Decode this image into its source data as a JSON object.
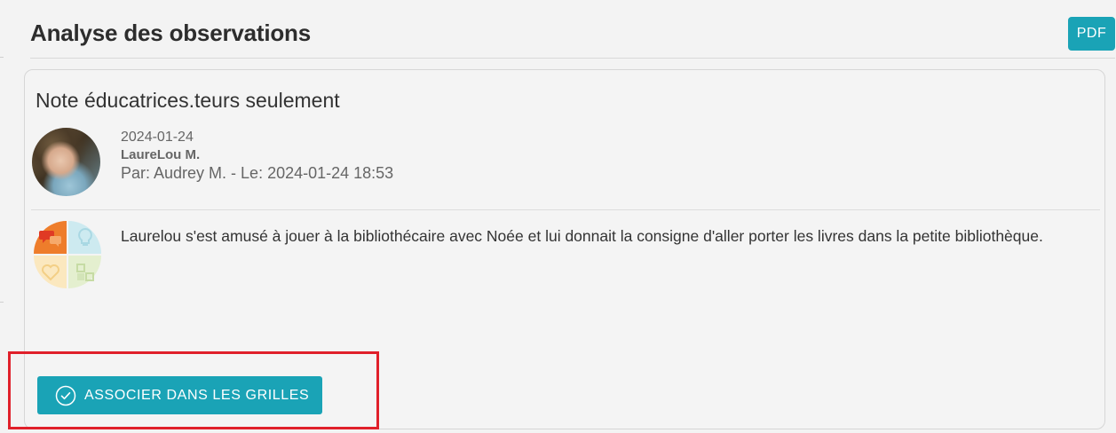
{
  "header": {
    "title": "Analyse des observations",
    "pdf_label": "PDF"
  },
  "note": {
    "title": "Note éducatrices.teurs seulement",
    "date": "2024-01-24",
    "child_name": "LaureLou M.",
    "author_line": "Par: Audrey M. - Le: 2024-01-24 18:53",
    "text": "Laurelou s'est amusé à jouer à la bibliothécaire avec Noée et lui donnait la consigne d'aller porter les livres dans la petite bibliothèque.",
    "development_domains_icon": "development-domains-icon"
  },
  "actions": {
    "associate_label": "ASSOCIER DANS LES GRILLES",
    "associate_icon": "check-circle-icon"
  },
  "colors": {
    "accent": "#1aa3b6",
    "highlight": "#e0202a",
    "domain_social": "#ee7d2b",
    "domain_cognitive": "#cdeaf0",
    "domain_affective": "#fbe8bf",
    "domain_motor": "#e4efcf"
  }
}
